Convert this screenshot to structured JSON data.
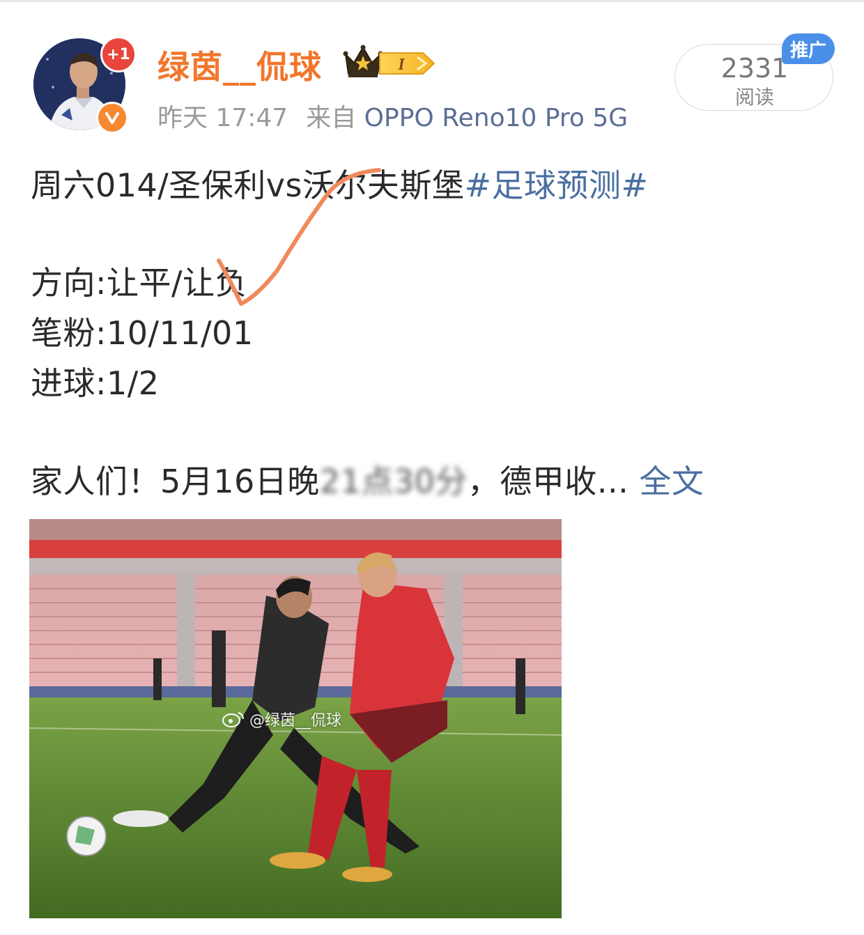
{
  "post": {
    "username": "绿茵__侃球",
    "level": "I",
    "notification_count": "+1",
    "time": "昨天 17:47",
    "source_prefix": "来自",
    "source_device": "OPPO Reno10 Pro 5G",
    "read_count": "2331",
    "read_label": "阅读",
    "promo_badge": "推广",
    "line1_text": "周六014/圣保利vs沃尔夫斯堡",
    "line1_tag": "#足球预测#",
    "direction": "方向:让平/让负",
    "picks": "笔粉:10/11/01",
    "goals": "进球:1/2",
    "teaser_start": "家人们！5月16日晚",
    "teaser_blurred": "21点30分",
    "teaser_end": "，德甲收...",
    "full_text_link": "全文",
    "image_watermark": "@绿茵__侃球"
  },
  "colors": {
    "username": "#f1762c",
    "link": "#4a6fa0",
    "check_mark": "#f08a5d",
    "promo_badge": "#4a8fe8"
  }
}
